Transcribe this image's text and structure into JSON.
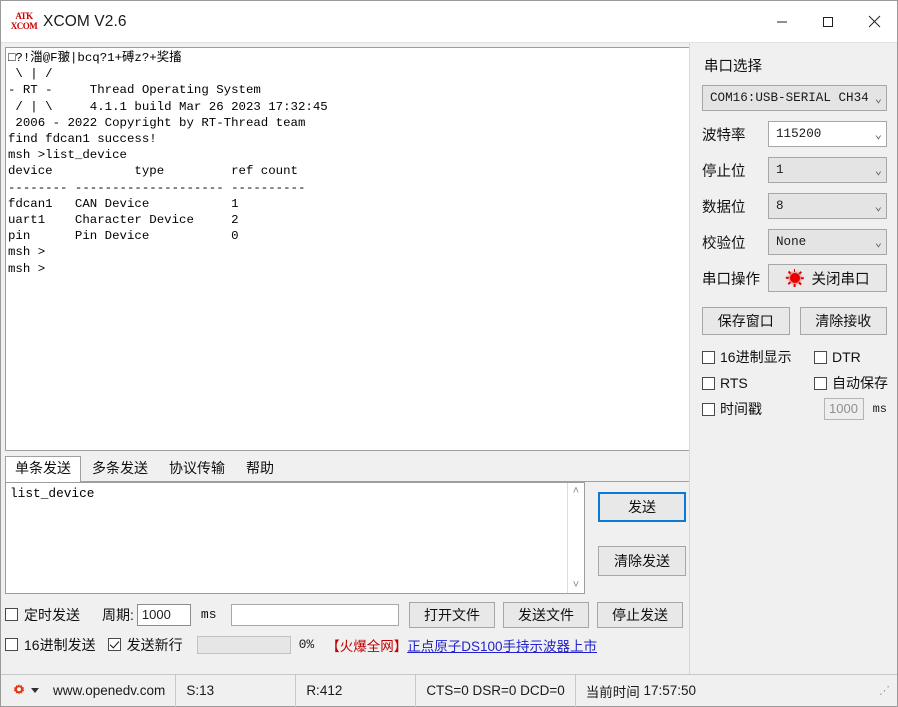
{
  "window": {
    "title": "XCOM V2.6",
    "logo_line1": "ATK",
    "logo_line2": "XCOM",
    "minimize_label": "—",
    "maximize_label": "□",
    "close_label": "✕"
  },
  "receive": {
    "text": "□?!湽@F翍|bcq?1+磗z?+奖搐\n \\ | /\n- RT -     Thread Operating System\n / | \\     4.1.1 build Mar 26 2023 17:32:45\n 2006 - 2022 Copyright by RT-Thread team\nfind fdcan1 success!\nmsh >list_device\ndevice           type         ref count\n-------- -------------------- ----------\nfdcan1   CAN Device           1\nuart1    Character Device     2\npin      Pin Device           0\nmsh >\nmsh >"
  },
  "tabs": [
    {
      "label": "单条发送",
      "active": true
    },
    {
      "label": "多条发送",
      "active": false
    },
    {
      "label": "协议传输",
      "active": false
    },
    {
      "label": "帮助",
      "active": false
    }
  ],
  "send": {
    "value": "list_device",
    "send_button": "发送",
    "clear_send_button": "清除发送",
    "scroll_up": "˄",
    "scroll_down": "˅"
  },
  "options": {
    "timed_send_label": "定时发送",
    "timed_send_checked": false,
    "period_label": "周期:",
    "period_value": "1000",
    "period_unit": "ms",
    "hex_send_label": "16进制发送",
    "hex_send_checked": false,
    "newline_label": "发送新行",
    "newline_checked": true,
    "file_path_value": "",
    "progress_percent": "0%",
    "progress_value": 0,
    "open_file_button": "打开文件",
    "send_file_button": "发送文件",
    "stop_send_button": "停止发送",
    "ad_hot": "【火爆全网】",
    "ad_link": "正点原子DS100手持示波器上市"
  },
  "serial_panel": {
    "title": "串口选择",
    "port_value": "COM16:USB-SERIAL CH34",
    "baud_label": "波特率",
    "baud_value": "115200",
    "stopbits_label": "停止位",
    "stopbits_value": "1",
    "databits_label": "数据位",
    "databits_value": "8",
    "parity_label": "校验位",
    "parity_value": "None",
    "operation_label": "串口操作",
    "operation_button": "关闭串口",
    "save_window_button": "保存窗口",
    "clear_recv_button": "清除接收",
    "hex_display_label": "16进制显示",
    "hex_display_checked": false,
    "dtr_label": "DTR",
    "dtr_checked": false,
    "rts_label": "RTS",
    "rts_checked": false,
    "autosave_label": "自动保存",
    "autosave_checked": false,
    "timestamp_label": "时间戳",
    "timestamp_checked": false,
    "timestamp_value": "1000",
    "timestamp_unit": "ms",
    "chevron": "⌄"
  },
  "statusbar": {
    "site": "www.openedv.com",
    "sent": "S:13",
    "received": "R:412",
    "signals": "CTS=0 DSR=0 DCD=0",
    "time_label": "当前时间",
    "time_value": "17:57:50"
  },
  "colors": {
    "accent_red": "#e60000",
    "link_blue": "#2222cc",
    "hot_red": "#c00000",
    "focus_blue": "#0a7ad8"
  }
}
